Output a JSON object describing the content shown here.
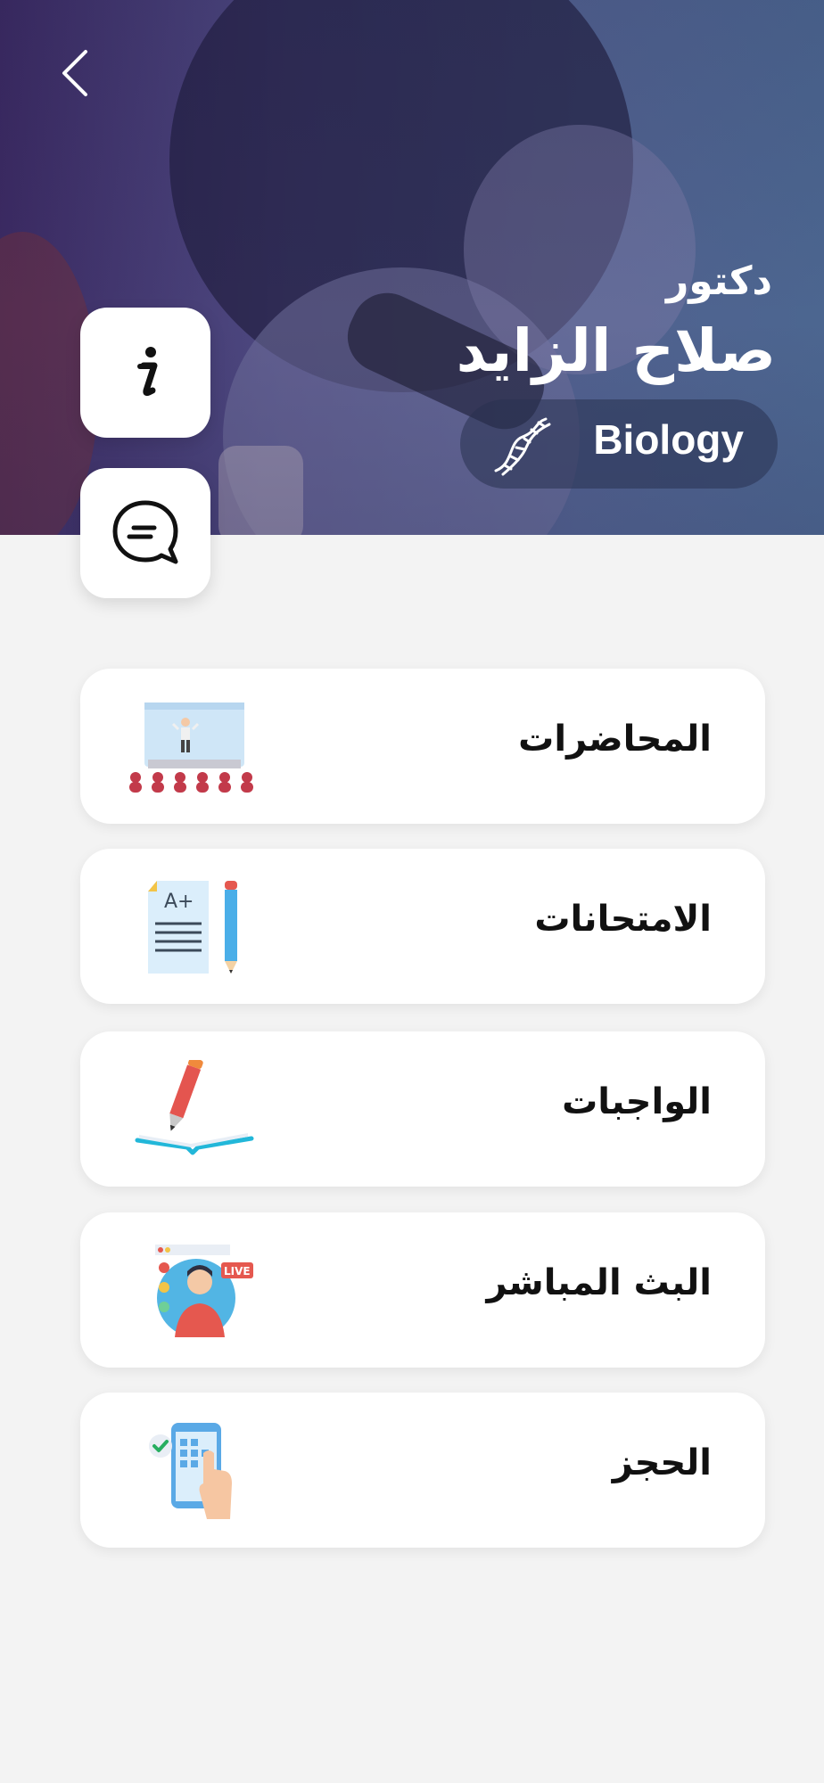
{
  "header": {
    "title_prefix": "دكتور",
    "name": "صلاح الزايد",
    "subject": "Biology",
    "subject_icon": "dna-icon",
    "back_icon": "chevron-left-icon"
  },
  "actions": {
    "info_icon": "info-icon",
    "chat_icon": "chat-bubble-icon"
  },
  "menu": {
    "items": [
      {
        "label": "المحاضرات",
        "icon": "lecture-hall-icon"
      },
      {
        "label": "الامتحانات",
        "icon": "exam-paper-icon"
      },
      {
        "label": "الواجبات",
        "icon": "homework-book-icon"
      },
      {
        "label": "البث المباشر",
        "icon": "live-stream-icon"
      },
      {
        "label": "الحجز",
        "icon": "booking-phone-icon"
      }
    ]
  }
}
